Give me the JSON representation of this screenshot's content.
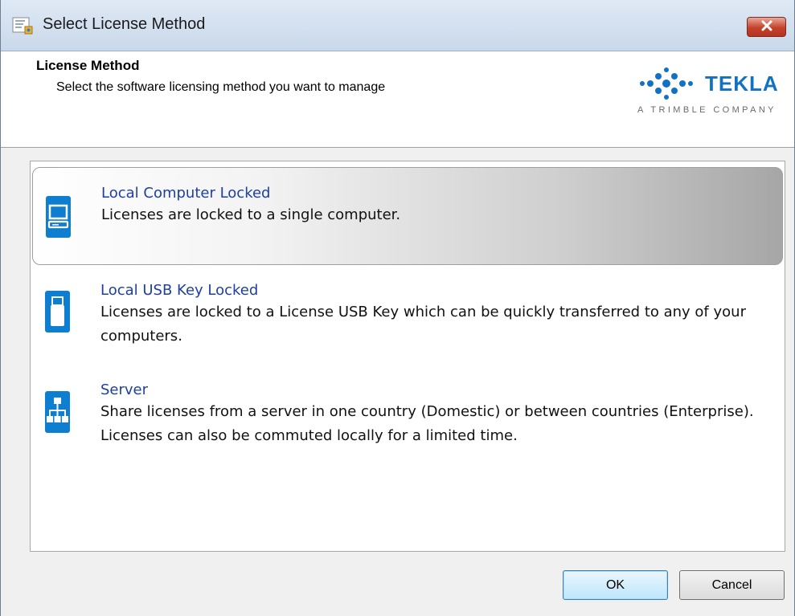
{
  "window": {
    "title": "Select License Method",
    "icon": "license-app-icon",
    "close_icon": "close-icon"
  },
  "header": {
    "title": "License Method",
    "subtitle": "Select the software licensing method you want to manage",
    "logo": {
      "brand": "TEKLA",
      "tagline": "A TRIMBLE COMPANY",
      "color": "#1172c4"
    }
  },
  "options": [
    {
      "icon": "computer-icon",
      "title": "Local Computer Locked",
      "description": "Licenses are locked to a single computer.",
      "selected": true
    },
    {
      "icon": "usb-key-icon",
      "title": "Local USB Key Locked",
      "description": "Licenses are locked to a License USB Key which can be quickly transferred to any of your computers.",
      "selected": false
    },
    {
      "icon": "server-icon",
      "title": "Server",
      "description": "Share licenses from a server in one country (Domestic) or between countries (Enterprise). Licenses can also be commuted locally for a limited time.",
      "selected": false
    }
  ],
  "buttons": {
    "ok_label": "OK",
    "cancel_label": "Cancel"
  },
  "colors": {
    "accent": "#0e7fd0",
    "option_title": "#1d3fa3",
    "close_button": "#c4412b"
  }
}
